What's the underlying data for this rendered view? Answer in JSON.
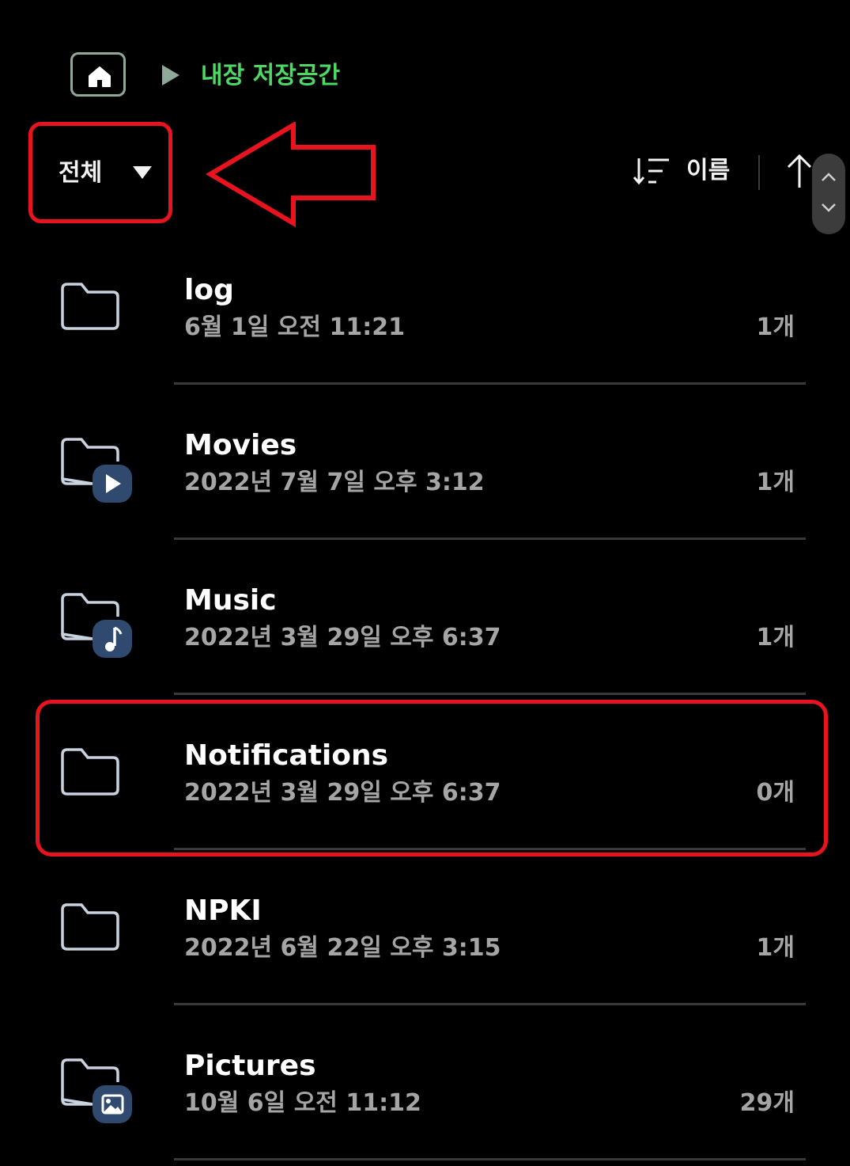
{
  "breadcrumb": {
    "home_icon": "home-icon",
    "separator_icon": "play-triangle-icon",
    "current": "내장 저장공간"
  },
  "toolbar": {
    "filter_label": "전체",
    "filter_icon": "caret-down-icon",
    "sort_icon": "sort-icon",
    "sort_label": "이름",
    "direction_icon": "arrow-up-icon"
  },
  "folders": [
    {
      "name": "log",
      "date": "6월 1일 오전 11:21",
      "count": "1개",
      "icon": "folder-icon"
    },
    {
      "name": "Movies",
      "date": "2022년 7월 7일 오후 3:12",
      "count": "1개",
      "icon": "video-folder-icon"
    },
    {
      "name": "Music",
      "date": "2022년 3월 29일 오후 6:37",
      "count": "1개",
      "icon": "music-folder-icon"
    },
    {
      "name": "Notifications",
      "date": "2022년 3월 29일 오후 6:37",
      "count": "0개",
      "icon": "folder-icon"
    },
    {
      "name": "NPKI",
      "date": "2022년 6월 22일 오후 3:15",
      "count": "1개",
      "icon": "folder-icon"
    },
    {
      "name": "Pictures",
      "date": "10월 6일 오전 11:12",
      "count": "29개",
      "icon": "image-folder-icon"
    }
  ],
  "colors": {
    "background": "#000000",
    "accent_green": "#4cd964",
    "annotation_red": "#e8131f",
    "badge_blue": "#2f4a6e",
    "secondary_text": "#a5a5a5"
  }
}
